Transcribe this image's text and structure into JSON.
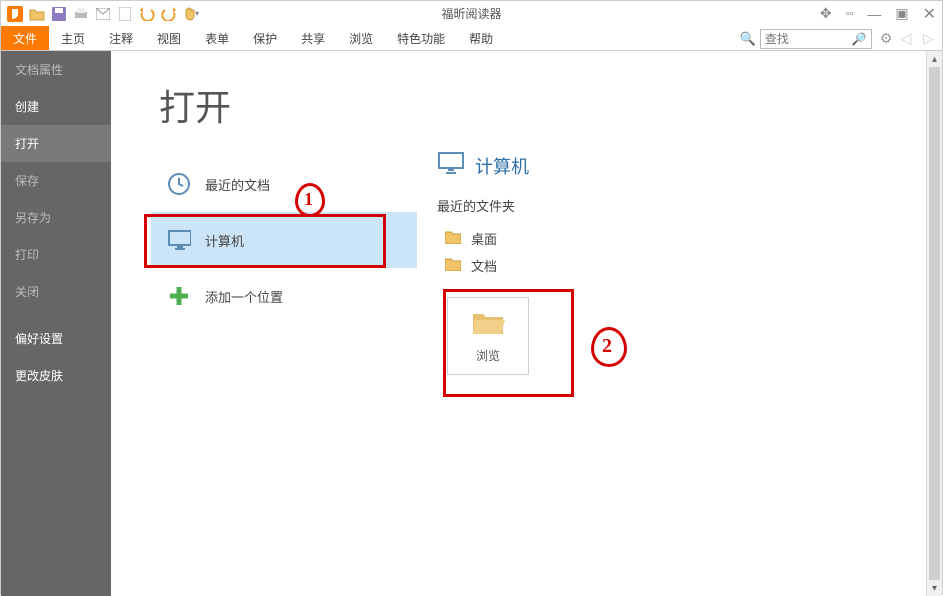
{
  "app": {
    "title": "福昕阅读器"
  },
  "qat_icons": [
    "app-logo",
    "open-icon",
    "save-icon",
    "print-icon",
    "email-icon",
    "options-icon",
    "undo-icon",
    "redo-icon",
    "hand-icon"
  ],
  "window_controls": [
    "pin-icon",
    "ribbon-icon",
    "minimize-icon",
    "restore-icon",
    "close-icon"
  ],
  "ribbon": {
    "tabs": [
      "文件",
      "主页",
      "注释",
      "视图",
      "表单",
      "保护",
      "共享",
      "浏览",
      "特色功能",
      "帮助"
    ],
    "active_index": 0,
    "search_placeholder": "查找"
  },
  "backstage": {
    "side_items": [
      {
        "label": "文档属性",
        "dim": true
      },
      {
        "label": "创建"
      },
      {
        "label": "打开",
        "selected": true
      },
      {
        "label": "保存",
        "dim": true
      },
      {
        "label": "另存为",
        "dim": true
      },
      {
        "label": "打印",
        "dim": true
      },
      {
        "label": "关闭",
        "dim": true
      },
      {
        "label": "偏好设置"
      },
      {
        "label": "更改皮肤"
      }
    ],
    "page_title": "打开",
    "locations": [
      {
        "icon": "clock-icon",
        "label": "最近的文档"
      },
      {
        "icon": "computer-icon",
        "label": "计算机",
        "selected": true
      },
      {
        "icon": "plus-icon",
        "label": "添加一个位置"
      }
    ],
    "right": {
      "title_icon": "computer-icon",
      "title": "计算机",
      "recent_label": "最近的文件夹",
      "folders": [
        {
          "icon": "folder-icon",
          "label": "桌面"
        },
        {
          "icon": "folder-icon",
          "label": "文档"
        }
      ],
      "browse": {
        "icon": "folder-open-icon",
        "label": "浏览"
      }
    }
  },
  "annotations": {
    "label1": "1",
    "label2": "2"
  }
}
